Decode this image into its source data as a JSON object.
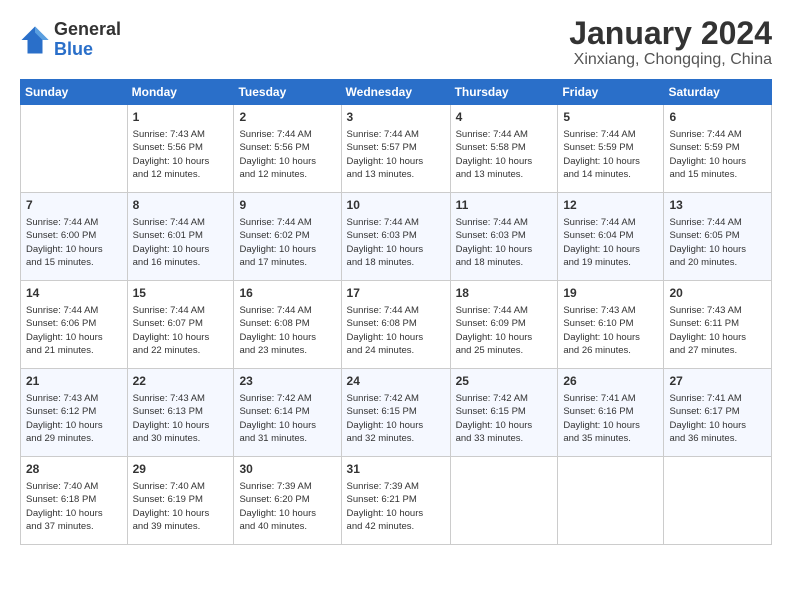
{
  "header": {
    "logo_general": "General",
    "logo_blue": "Blue",
    "month_title": "January 2024",
    "location": "Xinxiang, Chongqing, China"
  },
  "weekdays": [
    "Sunday",
    "Monday",
    "Tuesday",
    "Wednesday",
    "Thursday",
    "Friday",
    "Saturday"
  ],
  "weeks": [
    [
      {
        "day": "",
        "detail": ""
      },
      {
        "day": "1",
        "detail": "Sunrise: 7:43 AM\nSunset: 5:56 PM\nDaylight: 10 hours\nand 12 minutes."
      },
      {
        "day": "2",
        "detail": "Sunrise: 7:44 AM\nSunset: 5:56 PM\nDaylight: 10 hours\nand 12 minutes."
      },
      {
        "day": "3",
        "detail": "Sunrise: 7:44 AM\nSunset: 5:57 PM\nDaylight: 10 hours\nand 13 minutes."
      },
      {
        "day": "4",
        "detail": "Sunrise: 7:44 AM\nSunset: 5:58 PM\nDaylight: 10 hours\nand 13 minutes."
      },
      {
        "day": "5",
        "detail": "Sunrise: 7:44 AM\nSunset: 5:59 PM\nDaylight: 10 hours\nand 14 minutes."
      },
      {
        "day": "6",
        "detail": "Sunrise: 7:44 AM\nSunset: 5:59 PM\nDaylight: 10 hours\nand 15 minutes."
      }
    ],
    [
      {
        "day": "7",
        "detail": "Sunrise: 7:44 AM\nSunset: 6:00 PM\nDaylight: 10 hours\nand 15 minutes."
      },
      {
        "day": "8",
        "detail": "Sunrise: 7:44 AM\nSunset: 6:01 PM\nDaylight: 10 hours\nand 16 minutes."
      },
      {
        "day": "9",
        "detail": "Sunrise: 7:44 AM\nSunset: 6:02 PM\nDaylight: 10 hours\nand 17 minutes."
      },
      {
        "day": "10",
        "detail": "Sunrise: 7:44 AM\nSunset: 6:03 PM\nDaylight: 10 hours\nand 18 minutes."
      },
      {
        "day": "11",
        "detail": "Sunrise: 7:44 AM\nSunset: 6:03 PM\nDaylight: 10 hours\nand 18 minutes."
      },
      {
        "day": "12",
        "detail": "Sunrise: 7:44 AM\nSunset: 6:04 PM\nDaylight: 10 hours\nand 19 minutes."
      },
      {
        "day": "13",
        "detail": "Sunrise: 7:44 AM\nSunset: 6:05 PM\nDaylight: 10 hours\nand 20 minutes."
      }
    ],
    [
      {
        "day": "14",
        "detail": "Sunrise: 7:44 AM\nSunset: 6:06 PM\nDaylight: 10 hours\nand 21 minutes."
      },
      {
        "day": "15",
        "detail": "Sunrise: 7:44 AM\nSunset: 6:07 PM\nDaylight: 10 hours\nand 22 minutes."
      },
      {
        "day": "16",
        "detail": "Sunrise: 7:44 AM\nSunset: 6:08 PM\nDaylight: 10 hours\nand 23 minutes."
      },
      {
        "day": "17",
        "detail": "Sunrise: 7:44 AM\nSunset: 6:08 PM\nDaylight: 10 hours\nand 24 minutes."
      },
      {
        "day": "18",
        "detail": "Sunrise: 7:44 AM\nSunset: 6:09 PM\nDaylight: 10 hours\nand 25 minutes."
      },
      {
        "day": "19",
        "detail": "Sunrise: 7:43 AM\nSunset: 6:10 PM\nDaylight: 10 hours\nand 26 minutes."
      },
      {
        "day": "20",
        "detail": "Sunrise: 7:43 AM\nSunset: 6:11 PM\nDaylight: 10 hours\nand 27 minutes."
      }
    ],
    [
      {
        "day": "21",
        "detail": "Sunrise: 7:43 AM\nSunset: 6:12 PM\nDaylight: 10 hours\nand 29 minutes."
      },
      {
        "day": "22",
        "detail": "Sunrise: 7:43 AM\nSunset: 6:13 PM\nDaylight: 10 hours\nand 30 minutes."
      },
      {
        "day": "23",
        "detail": "Sunrise: 7:42 AM\nSunset: 6:14 PM\nDaylight: 10 hours\nand 31 minutes."
      },
      {
        "day": "24",
        "detail": "Sunrise: 7:42 AM\nSunset: 6:15 PM\nDaylight: 10 hours\nand 32 minutes."
      },
      {
        "day": "25",
        "detail": "Sunrise: 7:42 AM\nSunset: 6:15 PM\nDaylight: 10 hours\nand 33 minutes."
      },
      {
        "day": "26",
        "detail": "Sunrise: 7:41 AM\nSunset: 6:16 PM\nDaylight: 10 hours\nand 35 minutes."
      },
      {
        "day": "27",
        "detail": "Sunrise: 7:41 AM\nSunset: 6:17 PM\nDaylight: 10 hours\nand 36 minutes."
      }
    ],
    [
      {
        "day": "28",
        "detail": "Sunrise: 7:40 AM\nSunset: 6:18 PM\nDaylight: 10 hours\nand 37 minutes."
      },
      {
        "day": "29",
        "detail": "Sunrise: 7:40 AM\nSunset: 6:19 PM\nDaylight: 10 hours\nand 39 minutes."
      },
      {
        "day": "30",
        "detail": "Sunrise: 7:39 AM\nSunset: 6:20 PM\nDaylight: 10 hours\nand 40 minutes."
      },
      {
        "day": "31",
        "detail": "Sunrise: 7:39 AM\nSunset: 6:21 PM\nDaylight: 10 hours\nand 42 minutes."
      },
      {
        "day": "",
        "detail": ""
      },
      {
        "day": "",
        "detail": ""
      },
      {
        "day": "",
        "detail": ""
      }
    ]
  ]
}
